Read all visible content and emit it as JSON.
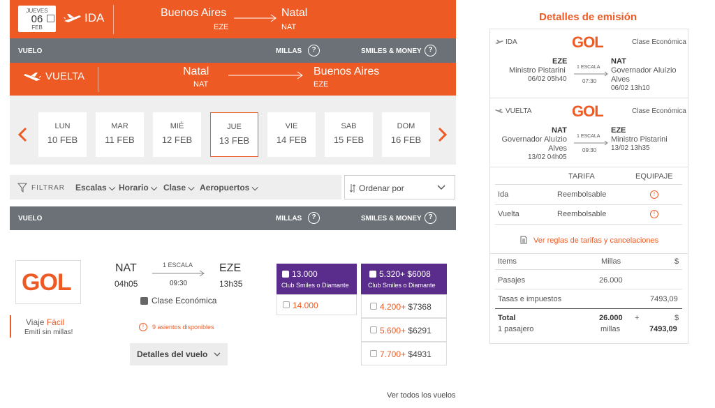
{
  "outbound": {
    "date_weekday": "JUEVES",
    "date_day": "06",
    "date_month": "FEB",
    "label": "IDA",
    "from_city": "Buenos Aires",
    "from_code": "EZE",
    "to_city": "Natal",
    "to_code": "NAT"
  },
  "header_row": {
    "vuelo": "VUELO",
    "millas": "MILLAS",
    "smiles_money": "SMILES & MONEY"
  },
  "return": {
    "label": "VUELTA",
    "from_city": "Natal",
    "from_code": "NAT",
    "to_city": "Buenos Aires",
    "to_code": "EZE"
  },
  "days": [
    {
      "name": "LUN",
      "date": "10 FEB"
    },
    {
      "name": "MAR",
      "date": "11 FEB"
    },
    {
      "name": "MIÉ",
      "date": "12 FEB"
    },
    {
      "name": "JUE",
      "date": "13 FEB"
    },
    {
      "name": "VIE",
      "date": "14 FEB"
    },
    {
      "name": "SAB",
      "date": "15 FEB"
    },
    {
      "name": "DOM",
      "date": "16 FEB"
    }
  ],
  "filters": {
    "label": "FILTRAR",
    "escalas": "Escalas",
    "horario": "Horario",
    "clase": "Clase",
    "aeropuertos": "Aeropuertos",
    "sort_placeholder": "Ordenar por"
  },
  "flight": {
    "airline": "GOL",
    "from_code": "NAT",
    "from_time": "04h05",
    "stops": "1 ESCALA",
    "duration": "09:30",
    "to_code": "EZE",
    "to_time": "13h35",
    "class": "Clase Económica",
    "seats": "9 asientos disponibles",
    "promo_prefix": "Viaje",
    "promo_highlight": "Fácil",
    "promo_sub": "Emití sin millas!",
    "details_button": "Detalles del vuelo"
  },
  "miles_fares": {
    "selected_value": "13.000",
    "selected_note": "Club Smiles o Diamante",
    "other": "14.000"
  },
  "money_fares": {
    "top_miles": "5.320+",
    "top_money": "$6008",
    "top_note": "Club Smiles o Diamante",
    "rows": [
      {
        "miles": "4.200+",
        "money": "$7368"
      },
      {
        "miles": "5.600+",
        "money": "$6291"
      },
      {
        "miles": "7.700+",
        "money": "$4931"
      }
    ]
  },
  "see_all": "Ver todos los vuelos",
  "details": {
    "title": "Detalles de emisión",
    "ida": {
      "label": "IDA",
      "airline": "GOL",
      "class": "Clase Económica",
      "from_code": "EZE",
      "from_name": "Ministro Pistarini",
      "from_dt": "06/02 05h40",
      "stops": "1 ESCALA",
      "duration": "07:30",
      "to_code": "NAT",
      "to_name_1": "Governador Aluízio",
      "to_name_2": "Alves",
      "to_dt": "06/02 13h10"
    },
    "vuelta": {
      "label": "VUELTA",
      "airline": "GOL",
      "class": "Clase Económica",
      "from_code": "NAT",
      "from_name_1": "Governador Aluízio",
      "from_name_2": "Alves",
      "from_dt": "13/02 04h05",
      "stops": "1 ESCALA",
      "duration": "09:30",
      "to_code": "EZE",
      "to_name": "Ministro Pistarini",
      "to_dt": "13/02 13h35"
    },
    "tarifa_header": "TARIFA",
    "equipaje_header": "EQUIPAJE",
    "ida_row_label": "Ida",
    "ida_row_fare": "Reembolsable",
    "vuelta_row_label": "Vuelta",
    "vuelta_row_fare": "Reembolsable",
    "rules_link": "Ver reglas de tarifas y cancelaciones",
    "items_header": "Items",
    "millas_header": "Millas",
    "currency_header": "$",
    "pasajes_label": "Pasajes",
    "pasajes_millas": "26.000",
    "tasas_label": "Tasas e impuestos",
    "tasas_value": "7493,09",
    "total_label": "Total",
    "total_millas": "26.000",
    "plus": "+",
    "total_currency": "$",
    "pasajero": "1 pasajero",
    "millas_word": "millas",
    "total_value": "7493,09"
  },
  "colors": {
    "accent": "#ee5a24",
    "grey_bar": "#6b7177",
    "purple": "#5a2d8c"
  }
}
